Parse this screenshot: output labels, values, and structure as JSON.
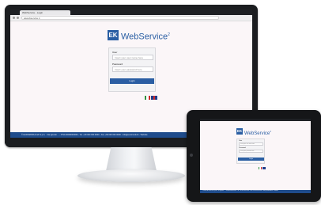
{
  "brand": {
    "logo_mark": "EK",
    "product_name": "WebService",
    "superscript": "2",
    "color": "#2a5ea3"
  },
  "browser": {
    "tab_title": "WebService - Login",
    "address": "ekwebservice.it"
  },
  "login": {
    "user_label": "User",
    "user_placeholder": "Insert your user name here",
    "password_label": "Password",
    "password_placeholder": "Insert your password here",
    "button_label": "Login"
  },
  "languages": [
    {
      "name": "italian",
      "colors": [
        "#2f8f3e",
        "#ffffff",
        "#cf2a2a"
      ]
    },
    {
      "name": "english",
      "colors": [
        "#213d8a",
        "#d22b2b",
        "#213d8a"
      ]
    }
  ],
  "footer": {
    "text": "© EUROMODUL EK S.p.A. - Via Ignazio ... - P.IVA 00000000000 - Tel. +39 000 000 0000 - Fax +39 000 000 0000 - info@euromodul.it - Website"
  },
  "colors": {
    "footer_bar": "#1f4c8c",
    "screen_bg": "#fbf6f8",
    "device_frame": "#1b1d20"
  }
}
